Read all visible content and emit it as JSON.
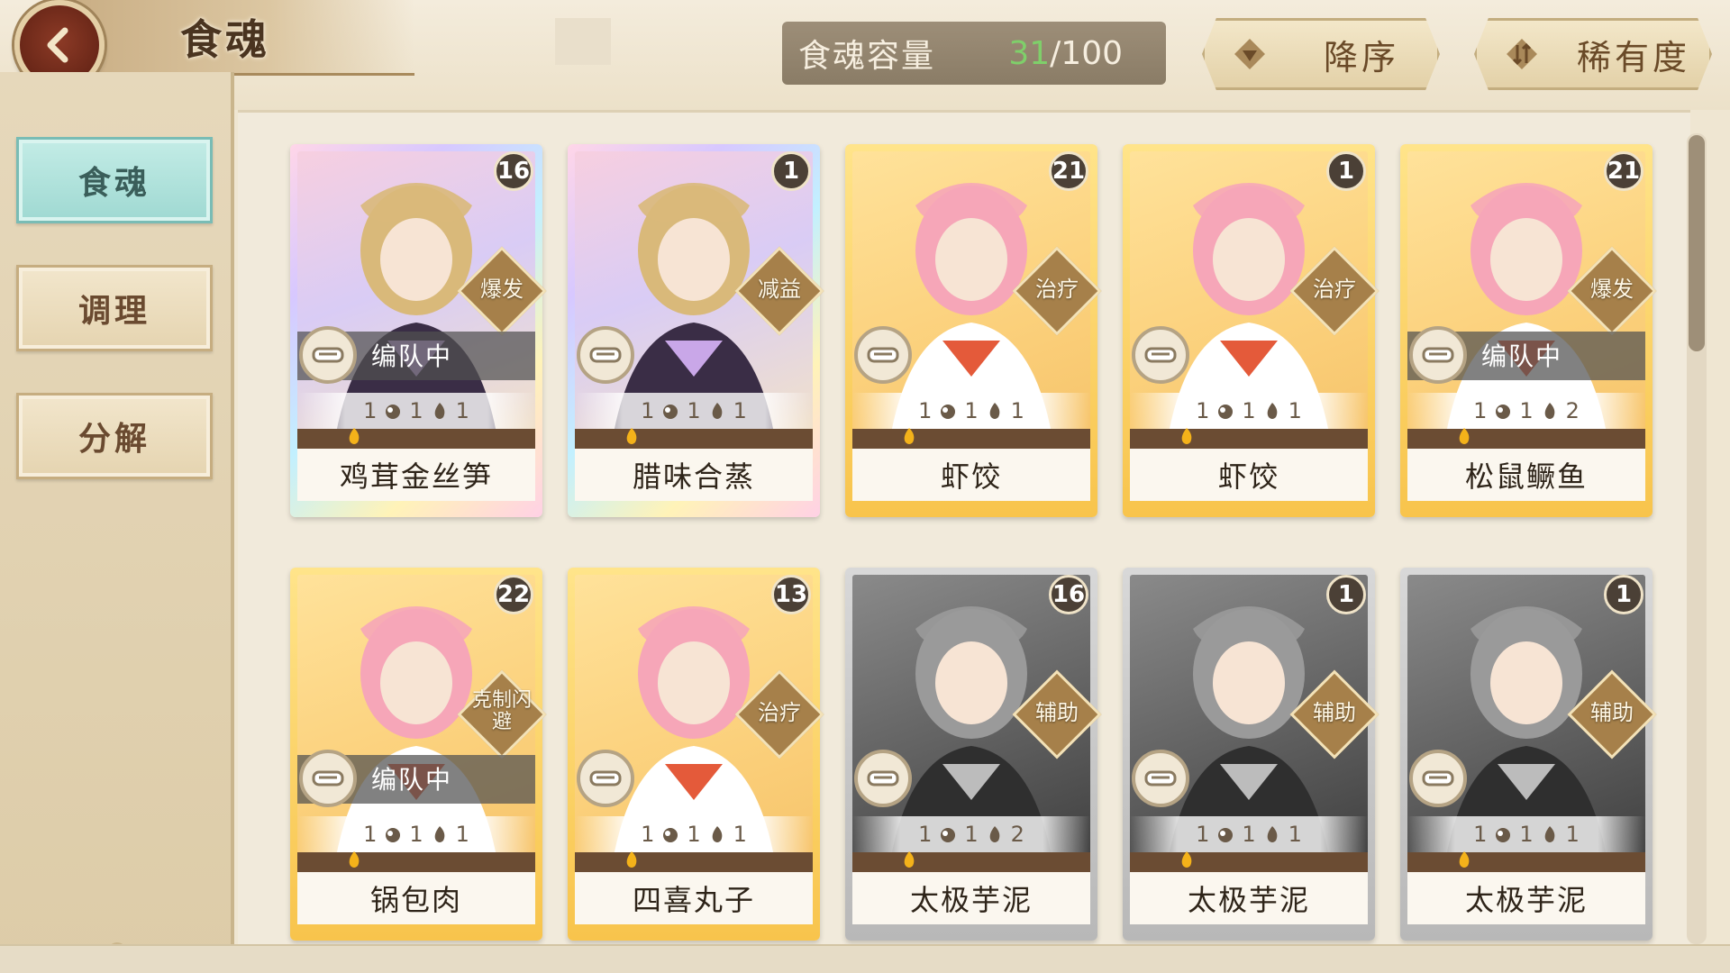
{
  "header": {
    "title": "食魂",
    "capacity_label": "食魂容量",
    "capacity_current": "31",
    "capacity_total": "/100",
    "sort_order_label": "降序",
    "sort_key_label": "稀有度"
  },
  "sidebar": {
    "items": [
      {
        "label": "食魂"
      },
      {
        "label": "调理"
      },
      {
        "label": "分解"
      }
    ]
  },
  "colors": {
    "active_tab": "#9fd9d2",
    "capacity_current": "#7fcf6a",
    "rare_rainbow": "#d7c8ff",
    "rare_gold": "#f8c44c",
    "rare_grey": "#b8b8b8"
  },
  "cards": [
    {
      "name": "鸡茸金丝笋",
      "level": "16",
      "role": "爆发",
      "team": "编队中",
      "stat1": "1",
      "stat2": "1",
      "stat3": "1",
      "rarity": "rainbow"
    },
    {
      "name": "腊味合蒸",
      "level": "1",
      "role": "减益",
      "team": "",
      "stat1": "1",
      "stat2": "1",
      "stat3": "1",
      "rarity": "rainbow"
    },
    {
      "name": "虾饺",
      "level": "21",
      "role": "治疗",
      "team": "",
      "stat1": "1",
      "stat2": "1",
      "stat3": "1",
      "rarity": "gold"
    },
    {
      "name": "虾饺",
      "level": "1",
      "role": "治疗",
      "team": "",
      "stat1": "1",
      "stat2": "1",
      "stat3": "1",
      "rarity": "gold"
    },
    {
      "name": "松鼠鳜鱼",
      "level": "21",
      "role": "爆发",
      "team": "编队中",
      "stat1": "1",
      "stat2": "1",
      "stat3": "2",
      "rarity": "gold"
    },
    {
      "name": "锅包肉",
      "level": "22",
      "role": "克制闪避",
      "team": "编队中",
      "stat1": "1",
      "stat2": "1",
      "stat3": "1",
      "rarity": "gold"
    },
    {
      "name": "四喜丸子",
      "level": "13",
      "role": "治疗",
      "team": "",
      "stat1": "1",
      "stat2": "1",
      "stat3": "1",
      "rarity": "gold"
    },
    {
      "name": "太极芋泥",
      "level": "16",
      "role": "辅助",
      "team": "",
      "stat1": "1",
      "stat2": "1",
      "stat3": "2",
      "rarity": "grey"
    },
    {
      "name": "太极芋泥",
      "level": "1",
      "role": "辅助",
      "team": "",
      "stat1": "1",
      "stat2": "1",
      "stat3": "1",
      "rarity": "grey"
    },
    {
      "name": "太极芋泥",
      "level": "1",
      "role": "辅助",
      "team": "",
      "stat1": "1",
      "stat2": "1",
      "stat3": "1",
      "rarity": "grey"
    }
  ]
}
